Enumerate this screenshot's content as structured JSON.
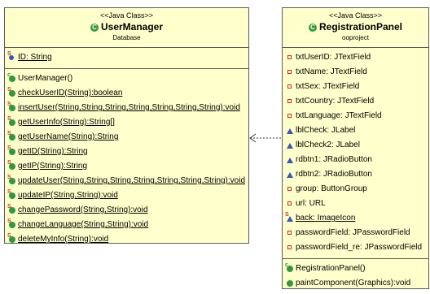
{
  "user_manager": {
    "stereotype": "<<Java Class>>",
    "name": "UserManager",
    "package": "Database",
    "fields": [
      {
        "text": "ID: String",
        "kind": "static-field"
      }
    ],
    "methods": [
      {
        "text": "UserManager()",
        "kind": "constructor"
      },
      {
        "text": "checkUserID(String):boolean",
        "kind": "static-method"
      },
      {
        "text": "insertUser(String,String,String,String,String,String,String):void",
        "kind": "static-method"
      },
      {
        "text": "getUserInfo(String):String[]",
        "kind": "static-method"
      },
      {
        "text": "getUserName(String):String",
        "kind": "static-method"
      },
      {
        "text": "getID(String):String",
        "kind": "static-method"
      },
      {
        "text": "getIP(String):String",
        "kind": "static-method"
      },
      {
        "text": "updateUser(String,String,String,String,String,String,String):void",
        "kind": "static-method"
      },
      {
        "text": "updateIP(String,String):void",
        "kind": "static-method"
      },
      {
        "text": "changePassword(String,String):void",
        "kind": "static-method"
      },
      {
        "text": "changeLanguage(String,String):void",
        "kind": "static-method"
      },
      {
        "text": "deleteMyInfo(String):void",
        "kind": "static-method"
      }
    ]
  },
  "registration_panel": {
    "stereotype": "<<Java Class>>",
    "name": "RegistrationPanel",
    "package": "ooproject",
    "fields": [
      {
        "text": "txtUserID: JTextField",
        "kind": "private-field"
      },
      {
        "text": "txtName: JTextField",
        "kind": "private-field"
      },
      {
        "text": "txtSex: JTextField",
        "kind": "private-field"
      },
      {
        "text": "txtCountry: JTextField",
        "kind": "private-field"
      },
      {
        "text": "txtLanguage: JTextField",
        "kind": "private-field"
      },
      {
        "text": "lblCheck: JLabel",
        "kind": "package-field"
      },
      {
        "text": "lblCheck2: JLabel",
        "kind": "package-field"
      },
      {
        "text": "rdbtn1: JRadioButton",
        "kind": "package-field"
      },
      {
        "text": "rdbtn2: JRadioButton",
        "kind": "package-field"
      },
      {
        "text": "group: ButtonGroup",
        "kind": "private-field"
      },
      {
        "text": "url: URL",
        "kind": "private-field"
      },
      {
        "text": "back: ImageIcon",
        "kind": "static-package-field"
      },
      {
        "text": "passwordField: JPasswordField",
        "kind": "private-field"
      },
      {
        "text": "passwordField_re: JPasswordField",
        "kind": "private-field"
      }
    ],
    "methods": [
      {
        "text": "RegistrationPanel()",
        "kind": "constructor"
      },
      {
        "text": "paintComponent(Graphics):void",
        "kind": "public-method"
      }
    ]
  },
  "colors": {
    "class_fill": "#ffffcc",
    "border": "#5a5a5a",
    "private": "#c82828",
    "package": "#3757b8",
    "public": "#2f9a3a"
  }
}
